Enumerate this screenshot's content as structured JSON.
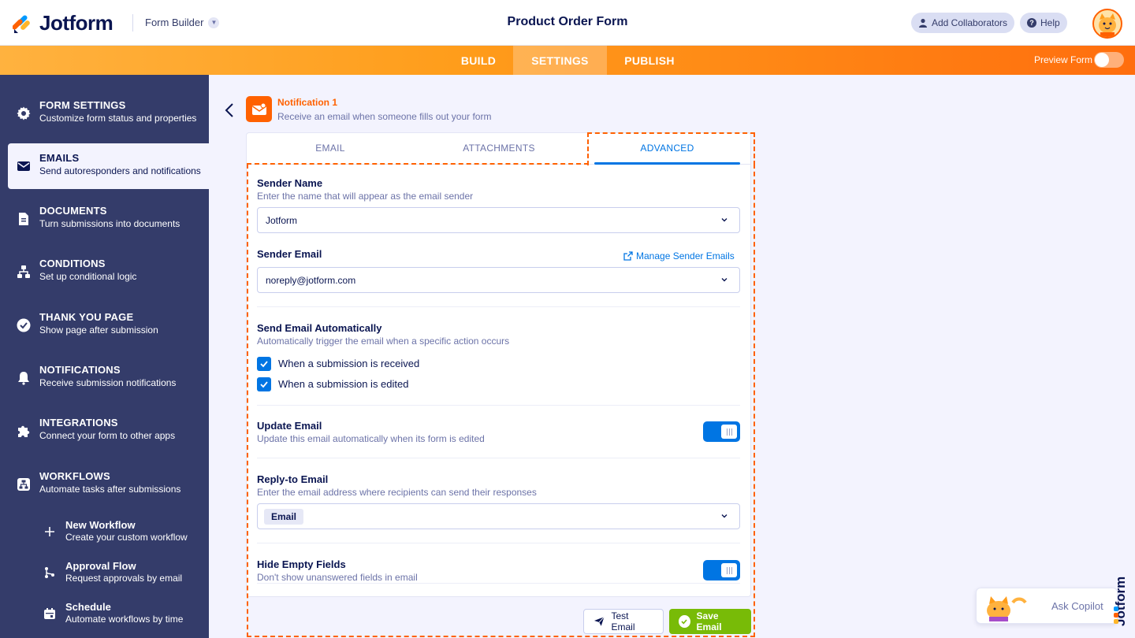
{
  "header": {
    "logo_text": "Jotform",
    "form_builder_label": "Form Builder",
    "form_title": "Product Order Form",
    "add_collaborators": "Add Collaborators",
    "help": "Help"
  },
  "nav": {
    "tabs": [
      {
        "label": "BUILD"
      },
      {
        "label": "SETTINGS",
        "active": true
      },
      {
        "label": "PUBLISH"
      }
    ],
    "preview_label": "Preview Form",
    "preview_enabled": false
  },
  "sidebar": {
    "items": [
      {
        "title": "FORM SETTINGS",
        "subtitle": "Customize form status and properties",
        "icon": "gear-icon"
      },
      {
        "title": "EMAILS",
        "subtitle": "Send autoresponders and notifications",
        "icon": "envelope-icon",
        "active": true
      },
      {
        "title": "DOCUMENTS",
        "subtitle": "Turn submissions into documents",
        "icon": "document-icon"
      },
      {
        "title": "CONDITIONS",
        "subtitle": "Set up conditional logic",
        "icon": "conditions-icon"
      },
      {
        "title": "THANK YOU PAGE",
        "subtitle": "Show page after submission",
        "icon": "check-circle-icon"
      },
      {
        "title": "NOTIFICATIONS",
        "subtitle": "Receive submission notifications",
        "icon": "bell-icon"
      },
      {
        "title": "INTEGRATIONS",
        "subtitle": "Connect your form to other apps",
        "icon": "puzzle-icon"
      },
      {
        "title": "WORKFLOWS",
        "subtitle": "Automate tasks after submissions",
        "icon": "workflow-icon"
      }
    ],
    "workflow_items": [
      {
        "title": "New Workflow",
        "subtitle": "Create your custom workflow",
        "icon": "plus-icon"
      },
      {
        "title": "Approval Flow",
        "subtitle": "Request approvals by email",
        "icon": "approval-flow-icon"
      },
      {
        "title": "Schedule",
        "subtitle": "Automate workflows by time",
        "icon": "calendar-icon"
      }
    ]
  },
  "notification": {
    "title": "Notification 1",
    "subtitle": "Receive an email when someone fills out your form"
  },
  "tabs": [
    {
      "label": "EMAIL"
    },
    {
      "label": "ATTACHMENTS"
    },
    {
      "label": "ADVANCED",
      "active": true
    }
  ],
  "advanced": {
    "sender_name": {
      "label": "Sender Name",
      "description": "Enter the name that will appear as the email sender",
      "value": "Jotform"
    },
    "sender_email": {
      "label": "Sender Email",
      "manage_link": "Manage Sender Emails",
      "value": "noreply@jotform.com"
    },
    "send_auto": {
      "label": "Send Email Automatically",
      "description": "Automatically trigger the email when a specific action occurs",
      "options": [
        {
          "label": "When a submission is received",
          "checked": true
        },
        {
          "label": "When a submission is edited",
          "checked": true
        }
      ]
    },
    "update_email": {
      "label": "Update Email",
      "description": "Update this email automatically when its form is edited",
      "enabled": true
    },
    "reply_to": {
      "label": "Reply-to Email",
      "description": "Enter the email address where recipients can send their responses",
      "value": "Email"
    },
    "hide_empty": {
      "label": "Hide Empty Fields",
      "description": "Don't show unanswered fields in email",
      "enabled": true
    }
  },
  "footer": {
    "test_email": "Test Email",
    "save_email": "Save Email"
  },
  "copilot": {
    "label": "Ask Copilot"
  },
  "colors": {
    "accent_orange": "#ff6100",
    "accent_blue": "#0075e3",
    "sidebar_bg": "#343c6a",
    "save_green": "#78bb07"
  }
}
